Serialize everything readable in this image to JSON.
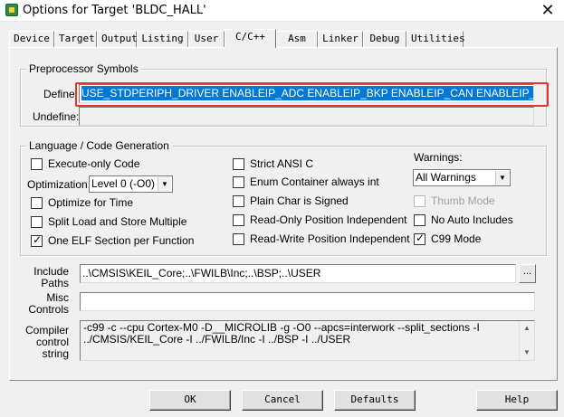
{
  "window": {
    "title": "Options for Target 'BLDC_HALL'",
    "close_glyph": "✕"
  },
  "tabs": [
    {
      "label": "Device"
    },
    {
      "label": "Target"
    },
    {
      "label": "Output"
    },
    {
      "label": "Listing"
    },
    {
      "label": "User"
    },
    {
      "label": "C/C++",
      "active": true
    },
    {
      "label": "Asm"
    },
    {
      "label": "Linker"
    },
    {
      "label": "Debug"
    },
    {
      "label": "Utilities"
    }
  ],
  "preprocessor": {
    "group_label": "Preprocessor Symbols",
    "define_label": "Define:",
    "define_value": "USE_STDPERIPH_DRIVER ENABLEIP_ADC ENABLEIP_BKP ENABLEIP_CAN ENABLEIP_COMP ENA",
    "undefine_label": "Undefine:",
    "undefine_value": ""
  },
  "language": {
    "group_label": "Language / Code Generation",
    "execute_only": {
      "label": "Execute-only Code",
      "checked": false
    },
    "optimization_label": "Optimization:",
    "optimization_value": "Level 0 (-O0)",
    "optimize_time": {
      "label": "Optimize for Time",
      "checked": false
    },
    "split_load": {
      "label": "Split Load and Store Multiple",
      "checked": false
    },
    "one_elf": {
      "label": "One ELF Section per Function",
      "checked": true
    },
    "strict_ansi": {
      "label": "Strict ANSI C",
      "checked": false
    },
    "enum_container": {
      "label": "Enum Container always int",
      "checked": false
    },
    "plain_char": {
      "label": "Plain Char is Signed",
      "checked": false
    },
    "ro_pos": {
      "label": "Read-Only Position Independent",
      "checked": false
    },
    "rw_pos": {
      "label": "Read-Write Position Independent",
      "checked": false
    },
    "warnings_label": "Warnings:",
    "warnings_value": "All Warnings",
    "thumb_mode": {
      "label": "Thumb Mode",
      "checked": false,
      "disabled": true
    },
    "no_auto_includes": {
      "label": "No Auto Includes",
      "checked": false
    },
    "c99_mode": {
      "label": "C99 Mode",
      "checked": true
    }
  },
  "paths": {
    "include_label_1": "Include",
    "include_label_2": "Paths",
    "include_value": "..\\CMSIS\\KEIL_Core;..\\FWILB\\Inc;..\\BSP;..\\USER",
    "browse_label": "...",
    "misc_label_1": "Misc",
    "misc_label_2": "Controls",
    "misc_value": "",
    "compiler_label_1": "Compiler",
    "compiler_label_2": "control",
    "compiler_label_3": "string",
    "compiler_line_1": "-c99 -c --cpu Cortex-M0 -D__MICROLIB -g -O0 --apcs=interwork --split_sections -I",
    "compiler_line_2": "../CMSIS/KEIL_Core -I ../FWILB/Inc -I ../BSP -I ../USER"
  },
  "buttons": {
    "ok": "OK",
    "cancel": "Cancel",
    "defaults": "Defaults",
    "help": "Help"
  },
  "colors": {
    "selection": "#0078d7",
    "highlight_box": "#e8322d"
  }
}
